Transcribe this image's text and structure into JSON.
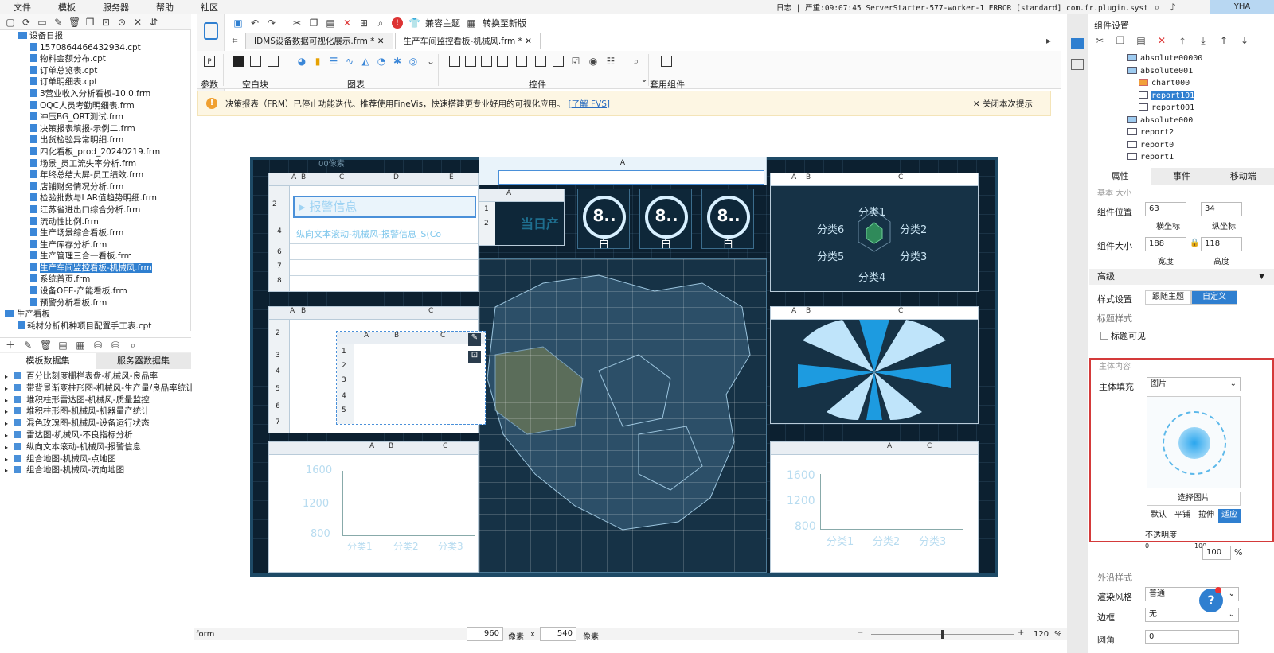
{
  "menu": {
    "items": [
      "文件",
      "模板",
      "服务器",
      "帮助",
      "社区"
    ],
    "status": "日志 | 严重:09:07:45 ServerStarter-577-worker-1 ERROR [standard] com.fr.plugin.system.operation.c...",
    "user": "YHA"
  },
  "filetree": [
    {
      "label": "设备日报",
      "kind": "folder",
      "indent": 1
    },
    {
      "label": "1570864466432934.cpt",
      "kind": "file",
      "indent": 2
    },
    {
      "label": "物料金额分布.cpt",
      "kind": "file",
      "indent": 2
    },
    {
      "label": "订单总览表.cpt",
      "kind": "file",
      "indent": 2
    },
    {
      "label": "订单明细表.cpt",
      "kind": "file",
      "indent": 2
    },
    {
      "label": "3营业收入分析看板-10.0.frm",
      "kind": "file",
      "indent": 2
    },
    {
      "label": "OQC人员考勤明细表.frm",
      "kind": "file",
      "indent": 2
    },
    {
      "label": "冲压BG_ORT测试.frm",
      "kind": "file",
      "indent": 2
    },
    {
      "label": "决策报表填报-示例二.frm",
      "kind": "file",
      "indent": 2
    },
    {
      "label": "出货检验异常明细.frm",
      "kind": "file",
      "indent": 2
    },
    {
      "label": "四化看板_prod_20240219.frm",
      "kind": "file",
      "indent": 2
    },
    {
      "label": "场景_员工流失率分析.frm",
      "kind": "file",
      "indent": 2
    },
    {
      "label": "年终总结大屏-员工绩效.frm",
      "kind": "file",
      "indent": 2
    },
    {
      "label": "店铺财务情况分析.frm",
      "kind": "file",
      "indent": 2
    },
    {
      "label": "检验批数与LAR值趋势明细.frm",
      "kind": "file",
      "indent": 2
    },
    {
      "label": "江苏省进出口综合分析.frm",
      "kind": "file",
      "indent": 2
    },
    {
      "label": "流动性比例.frm",
      "kind": "file",
      "indent": 2
    },
    {
      "label": "生产场景综合看板.frm",
      "kind": "file",
      "indent": 2
    },
    {
      "label": "生产库存分析.frm",
      "kind": "file",
      "indent": 2
    },
    {
      "label": "生产管理三合一看板.frm",
      "kind": "file",
      "indent": 2
    },
    {
      "label": "生产车间监控看板-机械风.frm",
      "kind": "file",
      "indent": 2,
      "selected": true
    },
    {
      "label": "系统首页.frm",
      "kind": "file",
      "indent": 2
    },
    {
      "label": "设备OEE-产能看板.frm",
      "kind": "file",
      "indent": 2
    },
    {
      "label": "预警分析看板.frm",
      "kind": "file",
      "indent": 2
    },
    {
      "label": "生产看板",
      "kind": "folder",
      "indent": 0
    },
    {
      "label": "耗材分析机种项目配置手工表.cpt",
      "kind": "file",
      "indent": 1
    }
  ],
  "datasets": {
    "tabs": [
      "模板数据集",
      "服务器数据集"
    ],
    "items": [
      "百分比刻度栅栏表盘-机械风-良品率",
      "带背景渐变柱形图-机械风-生产量/良品率统计",
      "堆积柱形雷达图-机械风-质量监控",
      "堆积柱形图-机械风-机器量产统计",
      "混色玫瑰图-机械风-设备运行状态",
      "雷达图-机械风-不良指标分析",
      "纵向文本滚动-机械风-报警信息",
      "组合地图-机械风-点地图",
      "组合地图-机械风-流向地图"
    ]
  },
  "toolbar": {
    "theme_label": "兼容主题",
    "switch_label": "转换至新版"
  },
  "tabs": [
    {
      "label": "IDMS设备数据可视化展示.frm *",
      "active": false
    },
    {
      "label": "生产车间监控看板-机械风.frm *",
      "active": true
    }
  ],
  "ribbon": {
    "groups": [
      "参数",
      "空白块",
      "图表",
      "控件",
      "套用组件"
    ]
  },
  "notice": {
    "text": "决策报表（FRM）已停止功能迭代。推荐使用FineVis，快速搭建更专业好用的可视化应用。",
    "link": "[了解 FVS]",
    "close": "关闭本次提示"
  },
  "dashboard": {
    "col_letters": [
      "A",
      "B",
      "C",
      "D",
      "E"
    ],
    "row_numbers": [
      "1",
      "2",
      "3",
      "4",
      "5",
      "6",
      "7",
      "8"
    ],
    "alarm_title": "报警信息",
    "alarm_text": "纵向文本滚动-机械风-报警信息_S(Co",
    "today_text": "当日产",
    "gauge_value": "8..",
    "gauge_sub": "白",
    "radar_labels": [
      "分类1",
      "分类2",
      "分类3",
      "分类4",
      "分类5",
      "分类6"
    ],
    "bar_axis": [
      "1600",
      "1200",
      "800"
    ],
    "bar_cats": [
      "分类1",
      "分类2",
      "分类3"
    ],
    "px_label": "00像素"
  },
  "bottom": {
    "mode": "form",
    "width": "960",
    "unit": "像素",
    "x": "x",
    "height": "540",
    "unit2": "像素",
    "zoom": "120",
    "pct": "%"
  },
  "rpanel": {
    "title": "组件设置",
    "tree": [
      {
        "label": "absolute00000",
        "indent": 1,
        "icon": "folder"
      },
      {
        "label": "absolute001",
        "indent": 1,
        "icon": "folder"
      },
      {
        "label": "chart000",
        "indent": 2,
        "icon": "chart"
      },
      {
        "label": "report101",
        "indent": 2,
        "icon": "report",
        "selected": true
      },
      {
        "label": "report001",
        "indent": 2,
        "icon": "report"
      },
      {
        "label": "absolute000",
        "indent": 1,
        "icon": "folder"
      },
      {
        "label": "report2",
        "indent": 1,
        "icon": "report"
      },
      {
        "label": "report0",
        "indent": 1,
        "icon": "report"
      },
      {
        "label": "report1",
        "indent": 1,
        "icon": "report"
      }
    ],
    "tabs": [
      "属性",
      "事件",
      "移动端"
    ],
    "section_cut": "基本 大小",
    "pos_label": "组件位置",
    "pos_x": "63",
    "pos_y": "34",
    "x_label": "横坐标",
    "y_label": "纵坐标",
    "size_label": "组件大小",
    "w": "188",
    "h": "118",
    "w_label": "宽度",
    "h_label": "高度",
    "advanced": "高级",
    "style_label": "样式设置",
    "style_opts": [
      "跟随主题",
      "自定义"
    ],
    "title_style": "标题样式",
    "title_visible": "标题可见",
    "body_content": "主体内容",
    "body_fill": "主体填充",
    "body_fill_val": "图片",
    "choose_img": "选择图片",
    "img_modes": [
      "默认",
      "平铺",
      "拉伸",
      "适应"
    ],
    "opacity_label": "不透明度",
    "opacity_min": "0",
    "opacity_max": "100",
    "opacity_val": "100",
    "opacity_pct": "%",
    "border_style": "外沿样式",
    "render_label": "渲染风格",
    "render_val": "普通",
    "border_label": "边框",
    "border_val": "无",
    "radius_label": "圆角",
    "radius_val": "0"
  }
}
